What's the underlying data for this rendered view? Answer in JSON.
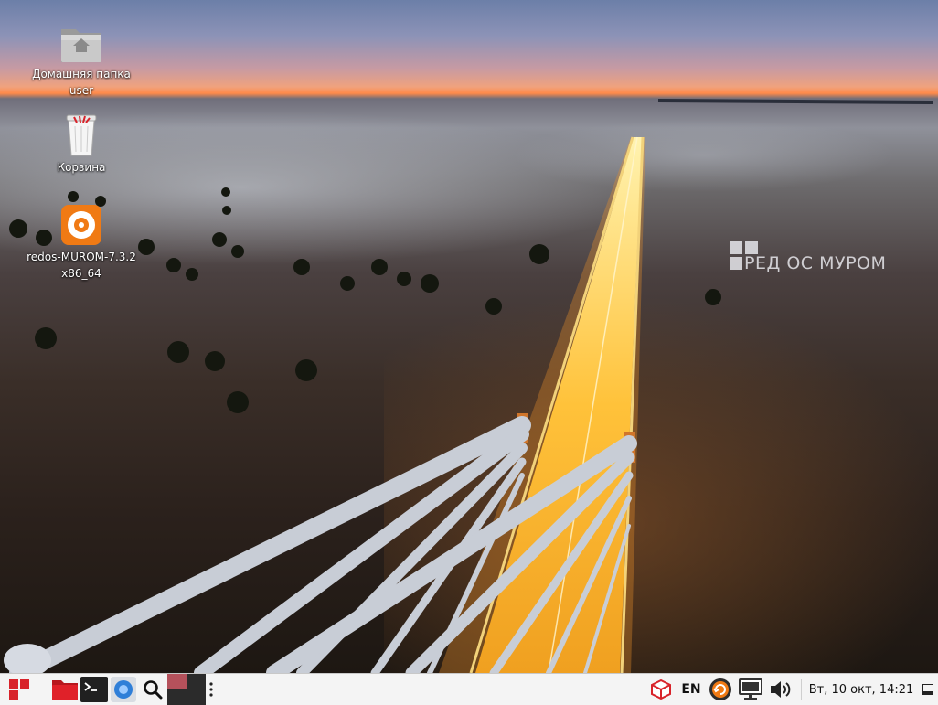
{
  "desktop": {
    "icons": [
      {
        "label_line1": "Домашняя папка",
        "label_line2": "user",
        "icon": "home-folder-icon"
      },
      {
        "label_line1": "Корзина",
        "icon": "trash-icon"
      },
      {
        "label_line1": "redos-MUROM-7.3.2",
        "label_line2": "x86_64",
        "icon": "disc-icon"
      }
    ],
    "watermark": {
      "text": "РЕД ОС МУРОМ"
    }
  },
  "taskbar": {
    "start_icon": "redos-menu-icon",
    "launchers": [
      "file-manager-icon",
      "terminal-icon",
      "browser-icon",
      "search-icon"
    ],
    "workspaces": [
      "workspace-1",
      "workspace-2",
      "workspace-3",
      "workspace-4"
    ],
    "tray": {
      "package_icon": "package-manager-icon",
      "language": "EN",
      "update_icon": "update-notifier-icon",
      "network_icon": "network-monitor-icon",
      "volume_icon": "volume-icon"
    },
    "clock": "Вт, 10 окт, 14:21",
    "show_desktop_icon": "show-desktop-icon"
  },
  "colors": {
    "brand_red": "#d8232a",
    "taskbar_bg": "#f4f4f4",
    "workspace_active": "#b5515b",
    "workspace_dark": "#2b2b2b"
  }
}
